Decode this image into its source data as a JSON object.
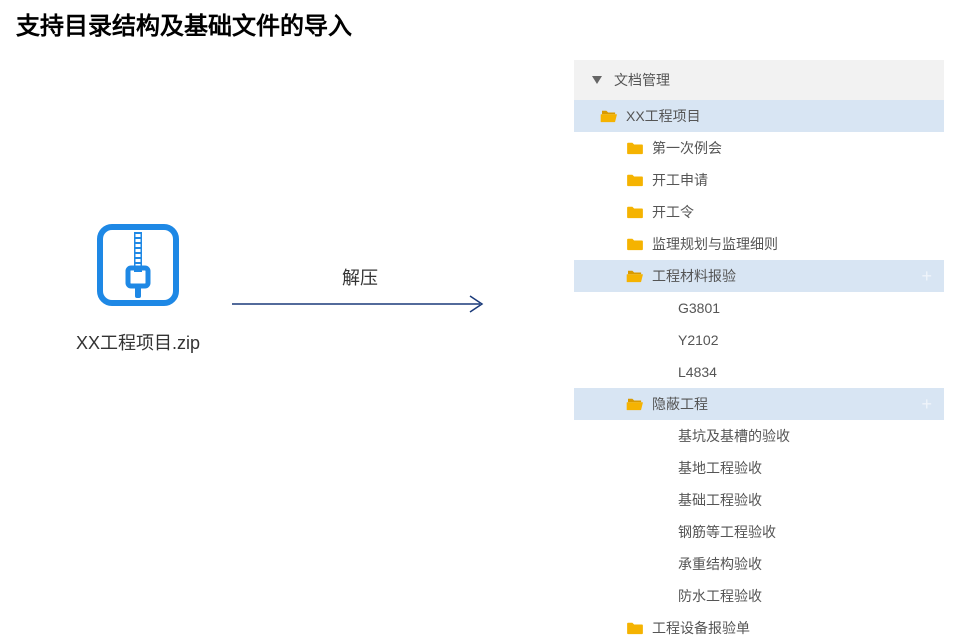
{
  "title": "支持目录结构及基础文件的导入",
  "zip": {
    "filename": "XX工程项目.zip"
  },
  "arrow": {
    "label": "解压"
  },
  "tree": {
    "header": "文档管理",
    "root": {
      "label": "XX工程项目",
      "children": [
        {
          "label": "第一次例会",
          "type": "folder"
        },
        {
          "label": "开工申请",
          "type": "folder"
        },
        {
          "label": "开工令",
          "type": "folder"
        },
        {
          "label": "监理规划与监理细则",
          "type": "folder"
        },
        {
          "label": "工程材料报验",
          "type": "folder-open",
          "selected": true,
          "children": [
            {
              "label": "G3801",
              "type": "file"
            },
            {
              "label": "Y2102",
              "type": "file"
            },
            {
              "label": "L4834",
              "type": "file"
            }
          ]
        },
        {
          "label": "隐蔽工程",
          "type": "folder-open",
          "selected": true,
          "children": [
            {
              "label": "基坑及基槽的验收",
              "type": "file"
            },
            {
              "label": "基地工程验收",
              "type": "file"
            },
            {
              "label": "基础工程验收",
              "type": "file"
            },
            {
              "label": "钢筋等工程验收",
              "type": "file"
            },
            {
              "label": "承重结构验收",
              "type": "file"
            },
            {
              "label": "防水工程验收",
              "type": "file"
            }
          ]
        },
        {
          "label": "工程设备报验单",
          "type": "folder"
        }
      ]
    }
  }
}
